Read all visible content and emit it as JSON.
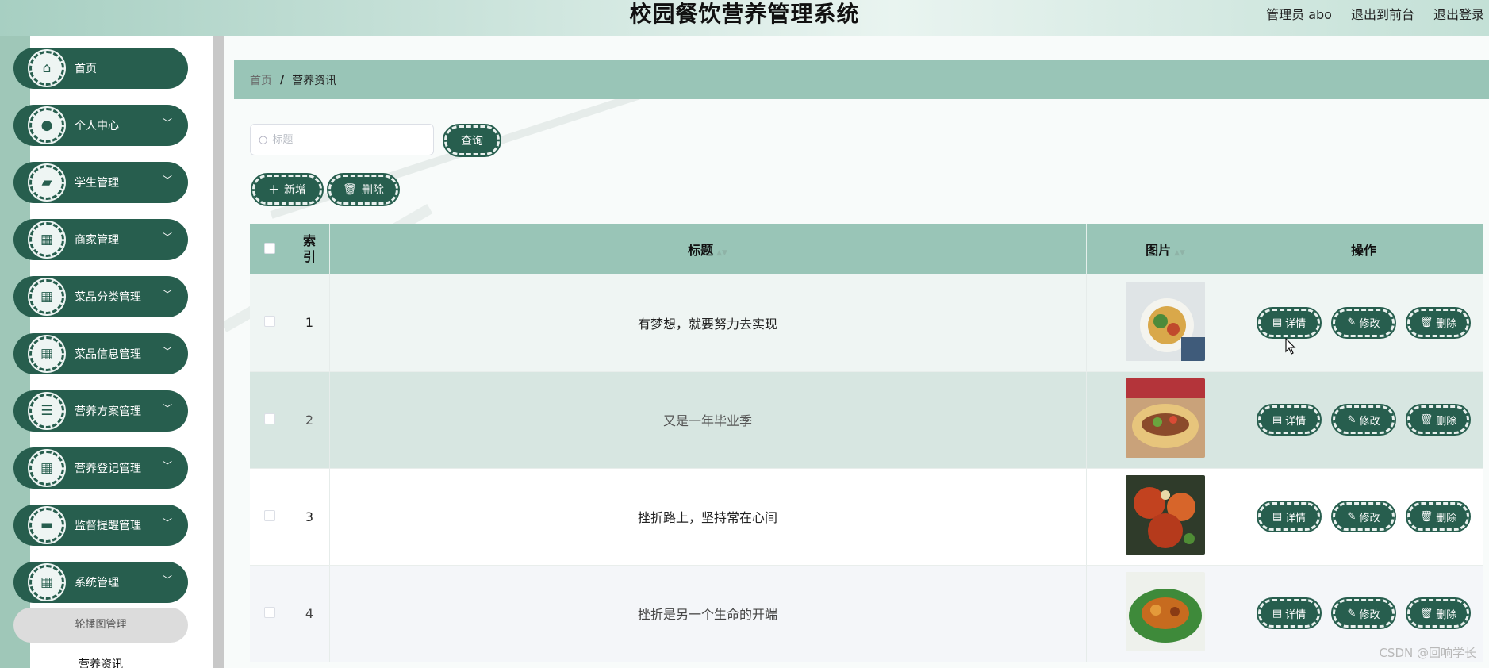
{
  "header": {
    "title": "校园餐饮营养管理系统",
    "user_label": "管理员 abo",
    "to_frontend": "退出到前台",
    "logout": "退出登录"
  },
  "sidebar": {
    "items": [
      {
        "label": "首页",
        "icon": "home-icon",
        "has_arrow": false
      },
      {
        "label": "个人中心",
        "icon": "user-icon",
        "has_arrow": true
      },
      {
        "label": "学生管理",
        "icon": "briefcase-icon",
        "has_arrow": true
      },
      {
        "label": "商家管理",
        "icon": "grid-icon",
        "has_arrow": true
      },
      {
        "label": "菜品分类管理",
        "icon": "grid-icon",
        "has_arrow": true
      },
      {
        "label": "菜品信息管理",
        "icon": "grid-icon",
        "has_arrow": true
      },
      {
        "label": "营养方案管理",
        "icon": "list-icon",
        "has_arrow": true
      },
      {
        "label": "营养登记管理",
        "icon": "grid-icon",
        "has_arrow": true
      },
      {
        "label": "监督提醒管理",
        "icon": "monitor-icon",
        "has_arrow": true
      },
      {
        "label": "系统管理",
        "icon": "grid-icon",
        "has_arrow": true
      }
    ],
    "submenu": [
      {
        "label": "轮播图管理"
      },
      {
        "label": "营养资讯"
      }
    ]
  },
  "breadcrumb": {
    "home": "首页",
    "separator": "/",
    "current": "营养资讯"
  },
  "search": {
    "placeholder": "标题",
    "value": ""
  },
  "toolbar": {
    "query_label": "查询",
    "add_label": "新增",
    "delete_label": "删除"
  },
  "table": {
    "headers": {
      "index": "索\n引",
      "title": "标题",
      "image": "图片",
      "actions": "操作"
    },
    "rows": [
      {
        "index": "1",
        "title": "有梦想，就要努力去实现"
      },
      {
        "index": "2",
        "title": "又是一年毕业季"
      },
      {
        "index": "3",
        "title": "挫折路上，坚持常在心间"
      },
      {
        "index": "4",
        "title": "挫折是另一个生命的开端"
      }
    ],
    "actions": {
      "detail": "详情",
      "edit": "修改",
      "delete": "删除"
    }
  },
  "watermark": "CSDN @回响学长",
  "colors": {
    "primary": "#275e4e",
    "header_row": "#99c5b7"
  }
}
